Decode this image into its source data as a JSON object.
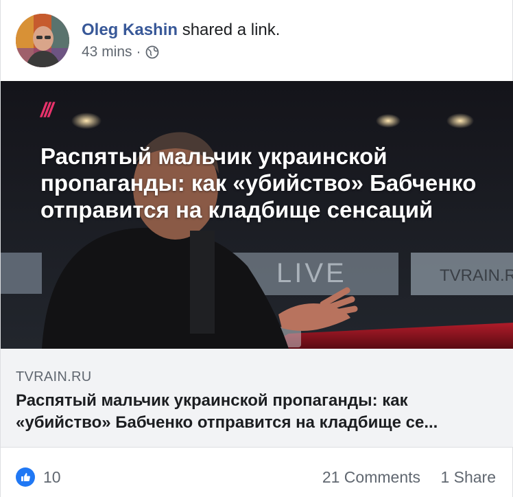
{
  "post": {
    "author_name": "Oleg Kashin",
    "action_text": "shared a link.",
    "timestamp": "43 mins",
    "separator": "·",
    "privacy_icon": "globe-icon"
  },
  "hero": {
    "channel_logo": "///",
    "headline": "Распятый мальчик украинской пропаганды: как «убийство» Бабченко отправится на кладбище сенсаций",
    "studio_sign_live": "LIVE",
    "studio_sign_tvrain": "TVRAIN.RU"
  },
  "link_preview": {
    "domain": "TVRAIN.RU",
    "title": "Распятый мальчик украинской пропаганды: как «убийство» Бабченко отправится на кладбище се..."
  },
  "footer": {
    "reaction_icon": "like-icon",
    "like_count": "10",
    "comments": "21 Comments",
    "shares": "1 Share"
  },
  "colors": {
    "author": "#385898",
    "secondary_text": "#606770",
    "link_bg": "#f2f3f5",
    "like_blue": "#2078f4",
    "logo_pink": "#e8326b"
  }
}
